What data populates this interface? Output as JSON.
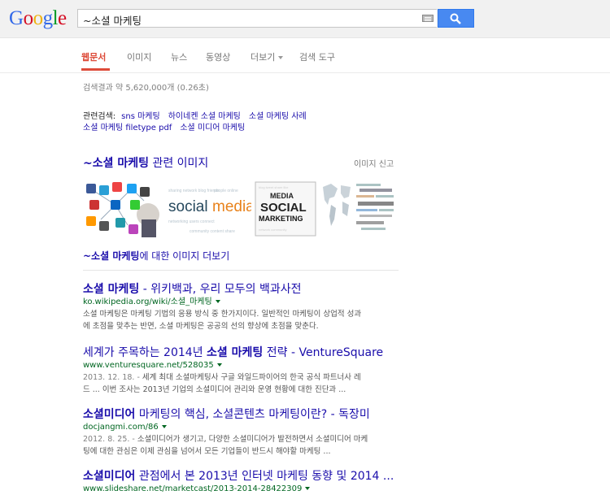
{
  "header": {
    "logo": [
      "G",
      "o",
      "o",
      "g",
      "l",
      "e"
    ],
    "query": "~소셜 마케팅",
    "keyboard_icon": "keyboard-icon",
    "search_icon": "magnifier-icon"
  },
  "tabs": [
    {
      "label": "웹문서",
      "active": true
    },
    {
      "label": "이미지"
    },
    {
      "label": "뉴스"
    },
    {
      "label": "동영상"
    },
    {
      "label": "더보기"
    },
    {
      "label": "검색 도구"
    }
  ],
  "stats": "검색결과 약 5,620,000개 (0.26초)",
  "related": {
    "label": "관련검색:",
    "items": [
      "sns 마케팅",
      "하이네켄 소셜 마케팅",
      "소셜 마케팅 사례",
      "소셜 마케팅 filetype pdf",
      "소셜 미디어 마케팅"
    ]
  },
  "images": {
    "heading_bold": "~소셜 마케팅",
    "heading_rest": " 관련 이미지",
    "report": "이미지 신고",
    "thumb_texts": [
      "social",
      "media",
      "MEDIA",
      "SOCIAL",
      "MARKETING"
    ],
    "more_bold": "~소셜 마케팅",
    "more_rest": "에 대한 이미지 더보기"
  },
  "results": [
    {
      "title_bold": "소셜 마케팅",
      "title_rest": " - 위키백과, 우리 모두의 백과사전",
      "url": "ko.wikipedia.org/wiki/소셜_마케팅",
      "date": "",
      "snippet_line1": "소셜 마케팅은 마케팅 기법의 응용 방식 중 한가지이다. 일반적인 마케팅이 상업적 성과",
      "snippet_line2": "에 초점을 맞추는 반면, 소셜 마케팅은 공공의 선의 향상에 초점을 맞춘다."
    },
    {
      "title_pre": "세계가 주목하는 2014년 ",
      "title_bold": "소셜 마케팅",
      "title_rest": " 전략 - VentureSquare",
      "url": "www.venturesquare.net/528035",
      "date": "2013. 12. 18. - ",
      "snippet_line1": "세계 최대 소셜마케팅사 구글 와일드파이어의 한국 공식 파트너사 레",
      "snippet_line2": "드 ... 이번 조사는 2013년 기업의 소셜미디어 관리와 운영 현황에 대한 진단과 ..."
    },
    {
      "title_bold": "소셜미디어",
      "title_rest": " 마케팅의 핵심, 소셜콘텐츠 마케팅이란? - 독장미",
      "url": "docjangmi.com/86",
      "date": "2012. 8. 25. - ",
      "snippet_line1": "소셜미디어가 생기고, 다양한 소셜미디어가 발전하면서 소셜미디어 마케",
      "snippet_line2": "팅에 대한 관심은 이제 관심을 넘어서 모든 기업들이 반드시 해야할 마케팅 ..."
    },
    {
      "title_bold": "소셜미디어",
      "title_rest": " 관점에서 본 2013년 인터넷 마케팅 동향 및 2014 ...",
      "url": "www.slideshare.net/marketcast/2013-2014-28422309",
      "date": "",
      "snippet_line1": "",
      "snippet_line2": ""
    }
  ]
}
